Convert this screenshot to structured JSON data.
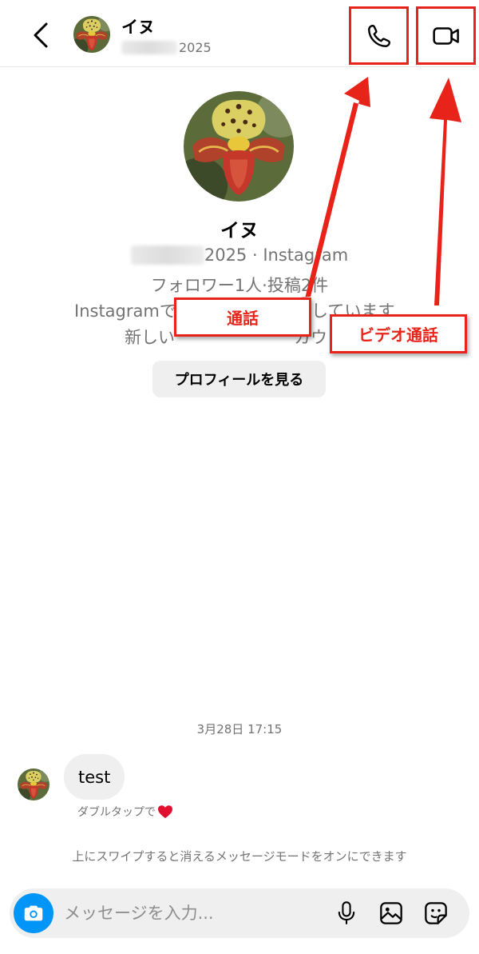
{
  "header": {
    "name": "イヌ",
    "subtitle_year": "2025"
  },
  "profile": {
    "name": "イヌ",
    "line1_suffix": "2025 · Instagram",
    "followers_posts": "フォロワー1人·投稿2件",
    "line3_left": "Instagramで",
    "line3_right": "しています",
    "line4_left": "新しい",
    "line4_right": "カウン",
    "view_profile_button": "プロフィールを見る"
  },
  "callouts": {
    "call_label": "通話",
    "video_label": "ビデオ通話",
    "color": "#e8241a"
  },
  "conversation": {
    "timestamp": "3月28日 17:15",
    "messages": [
      {
        "text": "test"
      }
    ],
    "double_tap_hint": "ダブルタップで",
    "swipe_hint": "上にスワイプすると消えるメッセージモードをオンにできます"
  },
  "composer": {
    "placeholder": "メッセージを入力...",
    "value": ""
  },
  "icons": {
    "back": "chevron-left-icon",
    "call": "phone-icon",
    "video": "video-camera-icon",
    "camera": "camera-icon",
    "mic": "microphone-icon",
    "gallery": "image-icon",
    "sticker": "sticker-icon",
    "heart": "heart-icon"
  },
  "colors": {
    "accent_blue": "#0095f6",
    "secondary_text": "#737373",
    "heart_red": "#e0102e"
  }
}
